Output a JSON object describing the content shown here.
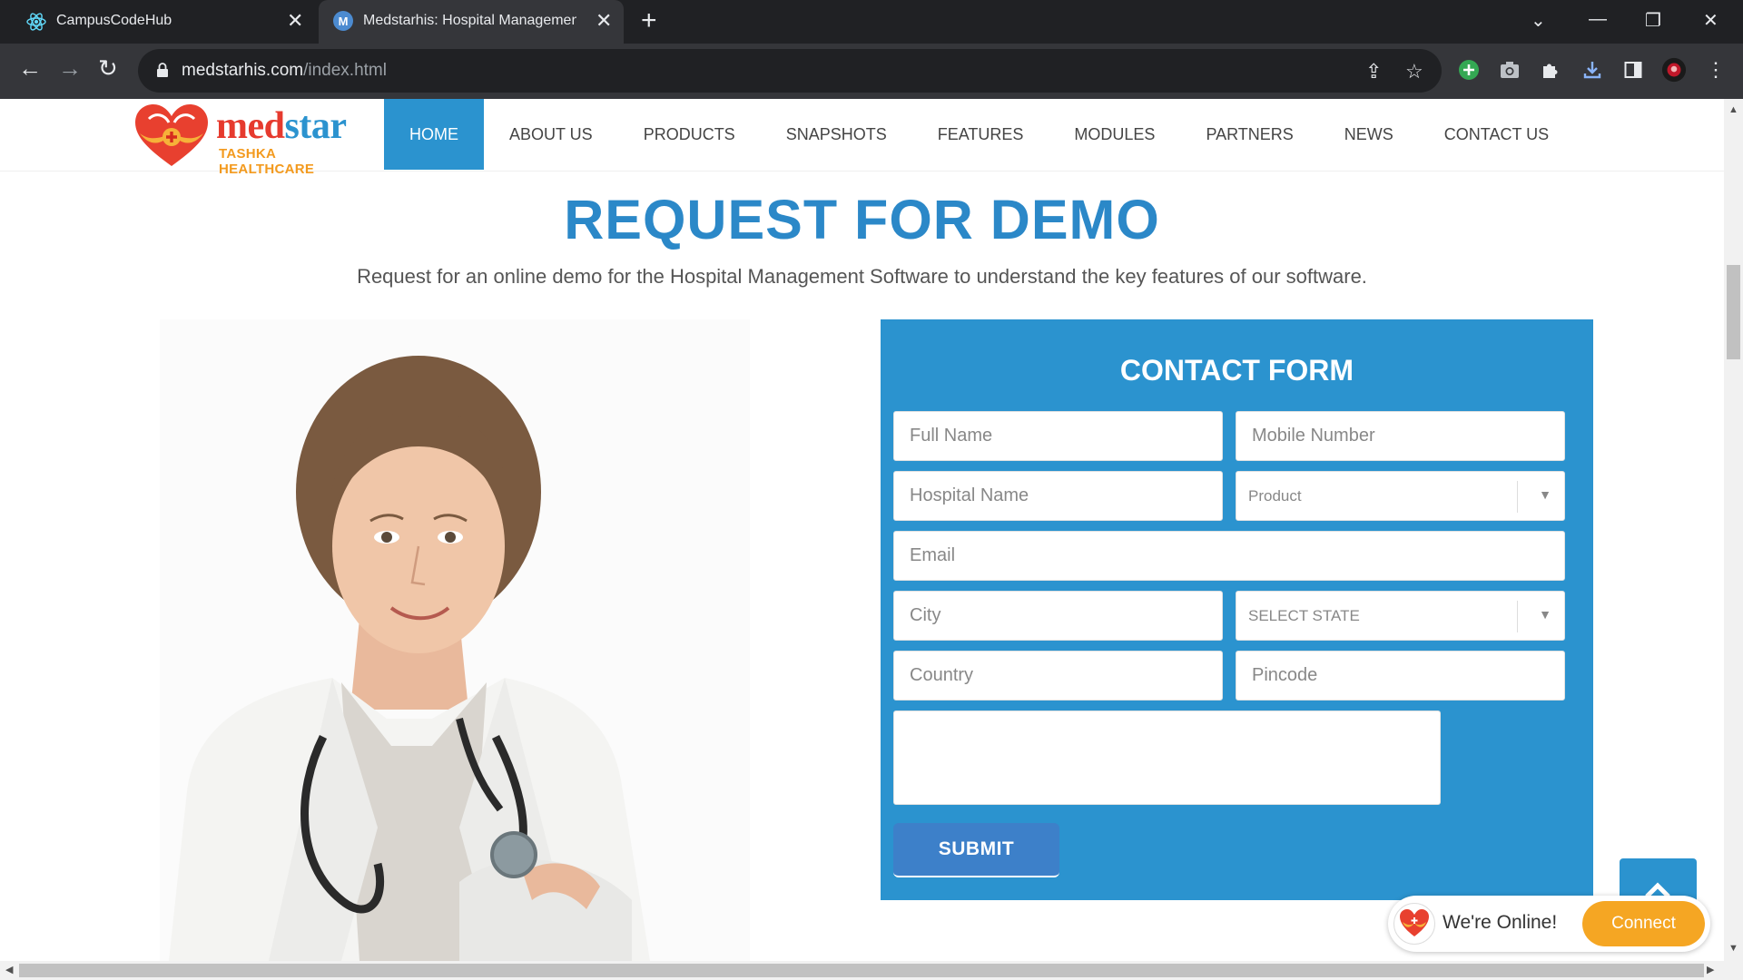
{
  "browser": {
    "tabs": [
      {
        "title": "CampusCodeHub",
        "icon": "react-icon"
      },
      {
        "title": "Medstarhis: Hospital Management",
        "icon_letter": "M"
      }
    ],
    "url_domain": "medstarhis.com",
    "url_path": "/index.html"
  },
  "site": {
    "logo": {
      "brand_part1": "med",
      "brand_part2": "star",
      "tagline": "TASHKA HEALTHCARE"
    },
    "menu": [
      "HOME",
      "ABOUT US",
      "PRODUCTS",
      "SNAPSHOTS",
      "FEATURES",
      "MODULES",
      "PARTNERS",
      "NEWS",
      "CONTACT US"
    ],
    "active_menu": "HOME",
    "hero_title": "REQUEST FOR DEMO",
    "hero_subtitle": "Request for an online demo for the Hospital Management Software to understand the key features of our software.",
    "form": {
      "title": "CONTACT FORM",
      "full_name_placeholder": "Full Name",
      "mobile_placeholder": "Mobile Number",
      "hospital_placeholder": "Hospital Name",
      "product_select": "Product",
      "email_placeholder": "Email",
      "city_placeholder": "City",
      "state_select": "SELECT STATE",
      "country_placeholder": "Country",
      "pincode_placeholder": "Pincode",
      "submit_label": "SUBMIT"
    },
    "chat": {
      "status": "We're Online!",
      "button": "Connect"
    }
  },
  "colors": {
    "brand_blue": "#2b93cf",
    "brand_red": "#e63a2e",
    "brand_orange": "#f39a1e",
    "chat_orange": "#f5a623"
  }
}
